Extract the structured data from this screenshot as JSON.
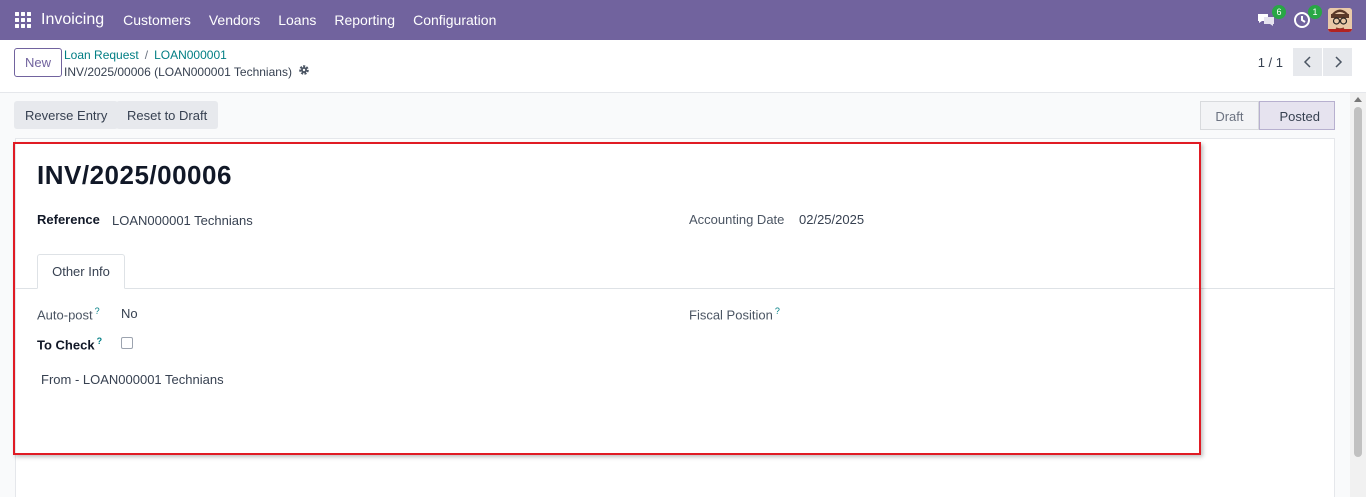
{
  "navbar": {
    "app_name": "Invoicing",
    "menu": [
      "Customers",
      "Vendors",
      "Loans",
      "Reporting",
      "Configuration"
    ],
    "messages_count": "6",
    "activities_count": "1",
    "icons": [
      "apps-grid-icon",
      "chat-icon",
      "clock-icon",
      "user-avatar"
    ],
    "color": "#71639e"
  },
  "control_panel": {
    "new_label": "New",
    "breadcrumb": [
      "Loan Request",
      "LOAN000001"
    ],
    "breadcrumb_separator": "/",
    "record_title": "INV/2025/00006 (LOAN000001 Technians)",
    "pager": "1 / 1"
  },
  "statusbar": {
    "actions": [
      "Reverse Entry",
      "Reset to Draft"
    ],
    "steps": [
      "Draft",
      "Posted"
    ],
    "active_step": "Posted"
  },
  "form": {
    "name": "INV/2025/00006",
    "reference_label": "Reference",
    "reference_value": "LOAN000001 Technians",
    "accounting_date_label": "Accounting Date",
    "accounting_date_value": "02/25/2025",
    "tab_label": "Other Info",
    "auto_post_label": "Auto-post",
    "auto_post_value": "No",
    "to_check_label": "To Check",
    "to_check_value": false,
    "fiscal_position_label": "Fiscal Position",
    "help_mark": "?",
    "narration": "From - LOAN000001 Technians"
  },
  "annotation": {
    "highlight_color": "#e01b24"
  }
}
